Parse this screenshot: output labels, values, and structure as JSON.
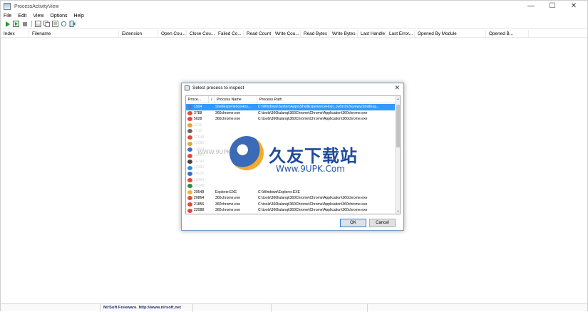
{
  "window": {
    "title": "ProcessActivityView",
    "controls": [
      "—",
      "☐",
      "✕"
    ]
  },
  "menu": [
    "File",
    "Edit",
    "View",
    "Options",
    "Help"
  ],
  "toolbar_icons": [
    "play-icon",
    "play-settings-icon",
    "stop-icon",
    "save-icon",
    "copy-icon",
    "properties-icon",
    "refresh-icon",
    "exit-icon"
  ],
  "columns": [
    "Index",
    "Filename",
    "Extension",
    "Open Cou...",
    "Close Cou...",
    "Failed Co...",
    "Read Count",
    "Write Cou...",
    "Read Bytes",
    "Write Bytes",
    "Last Handle",
    "Last Error...",
    "Opened By Module",
    "Opened B..."
  ],
  "status": {
    "text": "NirSoft Freeware.  http://www.nirsoft.net"
  },
  "dialog": {
    "title": "Select process to inspect",
    "close": "✕",
    "columns": [
      "Proce...",
      "/",
      "Process Name",
      "Process Path"
    ],
    "ok_label": "OK",
    "cancel_label": "Cancel",
    "rows": [
      {
        "pid": "1504",
        "name": "ShellExperienceHos...",
        "path": "C:\\Windows\\SystemApps\\ShellExperienceHost_cw5n1h2txyewy\\ShellExp...",
        "icon": "#5a7fb5",
        "sel": true
      },
      {
        "pid": "3788",
        "name": "360chrome.exe",
        "path": "C:\\tools\\360liulanqi\\360Chrome\\Chrome\\Application\\360chrome.exe",
        "icon": "#e04a3a"
      },
      {
        "pid": "5628",
        "name": "360chrome.exe",
        "path": "C:\\tools\\360liulanqi\\360Chrome\\Chrome\\Application\\360chrome.exe",
        "icon": "#e04a3a"
      },
      {
        "pid": "6316",
        "name": "",
        "path": "",
        "icon": "#e8a33a",
        "faded": true
      },
      {
        "pid": "7132",
        "name": "",
        "path": "",
        "icon": "#666666",
        "faded": true
      },
      {
        "pid": "12648",
        "name": "",
        "path": "",
        "icon": "#e04a3a",
        "faded": true
      },
      {
        "pid": "13080",
        "name": "",
        "path": "",
        "icon": "#e8a33a",
        "faded": true
      },
      {
        "pid": "13824",
        "name": "",
        "path": "",
        "icon": "#3c6fc0",
        "faded": true
      },
      {
        "pid": "14584",
        "name": "",
        "path": "",
        "icon": "#e04a3a",
        "faded": true
      },
      {
        "pid": "14740",
        "name": "",
        "path": "",
        "icon": "#444444",
        "faded": true
      },
      {
        "pid": "16392",
        "name": "",
        "path": "",
        "icon": "#2f8fd6",
        "faded": true
      },
      {
        "pid": "18132",
        "name": "",
        "path": "",
        "icon": "#3c6fc0",
        "faded": true
      },
      {
        "pid": "18484",
        "name": "",
        "path": "",
        "icon": "#e04a3a",
        "faded": true
      },
      {
        "pid": "18748",
        "name": "",
        "path": "",
        "icon": "#2e8b3a",
        "faded": true
      },
      {
        "pid": "20548",
        "name": "Explorer.EXE",
        "path": "C:\\Windows\\Explorer.EXE",
        "icon": "#e8b83a"
      },
      {
        "pid": "20864",
        "name": "360chrome.exe",
        "path": "C:\\tools\\360liulanqi\\360Chrome\\Chrome\\Application\\360chrome.exe",
        "icon": "#e04a3a"
      },
      {
        "pid": "21856",
        "name": "360chrome.exe",
        "path": "C:\\tools\\360liulanqi\\360Chrome\\Chrome\\Application\\360chrome.exe",
        "icon": "#e04a3a"
      },
      {
        "pid": "22088",
        "name": "360chrome.exe",
        "path": "C:\\tools\\360liulanqi\\360Chrome\\Chrome\\Application\\360chrome.exe",
        "icon": "#e04a3a"
      }
    ]
  },
  "watermark": {
    "brand": "久友下载站",
    "url": "Www.9UPK.Com",
    "small": "WWW.9UPK.COM"
  }
}
